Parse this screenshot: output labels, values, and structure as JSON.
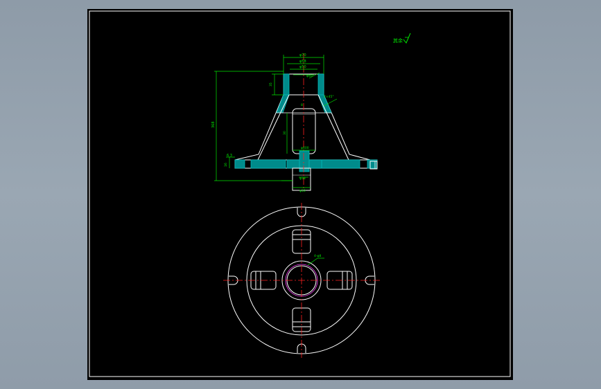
{
  "viewport": {
    "background": "#95a2ae"
  },
  "sheet": {
    "background": "#000000",
    "frame_color": "#ffffff"
  },
  "colors": {
    "outline": "#ffffff",
    "dimension": "#00e600",
    "hatch": "#00b8b8",
    "centerline": "#ff2020",
    "section_fill": "#008b8b",
    "yellow_text": "#ffff00",
    "magenta": "#ff40ff"
  },
  "annotations": {
    "roughness_note": "其余",
    "top_width_outer": "φ70",
    "top_width_mid": "φ58",
    "top_width_inner": "φ50",
    "top_bore": "φ40",
    "top_height": "35",
    "total_height": "368",
    "slot_height": "30",
    "cone_wall": "8",
    "flange_label": "6.3",
    "base_thickness": "16",
    "base_width": "φ400",
    "shaft_dia": "φ38",
    "shaft_bottom": "φ50",
    "chamfer_note": "2×45°",
    "hole_callout": "4-φ8"
  }
}
